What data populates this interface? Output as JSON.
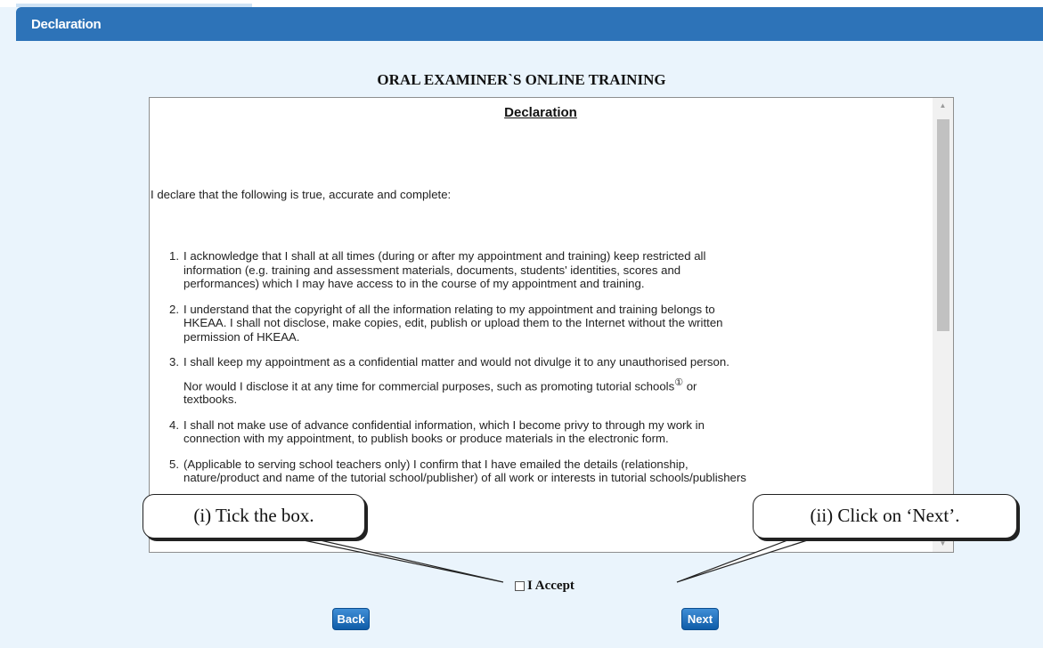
{
  "header": {
    "title": "Declaration"
  },
  "page_heading": "ORAL EXAMINER`S ONLINE TRAINING",
  "declaration": {
    "title": "Declaration",
    "intro": "I declare that the following is true, accurate and complete:",
    "items": [
      {
        "number": "1.",
        "lines": [
          "I acknowledge that I shall at all times (during or after my appointment and training) keep restricted all",
          "information (e.g. training and assessment materials, documents, students' identities, scores and",
          "performances) which I may have access to in the course of my appointment and training."
        ]
      },
      {
        "number": "2.",
        "lines": [
          "I understand that the copyright of all the information relating to my appointment and training belongs to",
          "HKEAA. I shall not disclose, make copies, edit, publish or upload them to the Internet without the written",
          "permission of HKEAA."
        ]
      },
      {
        "number": "3.",
        "first": "I shall keep my appointment as a confidential matter and would not divulge it to any unauthorised person.",
        "second_a": "Nor would I disclose it at any time for commercial purposes, such as promoting tutorial schools",
        "note_mark": "①",
        "second_b": " or",
        "third": "textbooks."
      },
      {
        "number": "4.",
        "lines": [
          "I shall not make use of advance confidential information, which I become privy to through my work in",
          "connection with my appointment, to publish books or produce materials in the electronic form."
        ]
      },
      {
        "number": "5.",
        "lines": [
          "(Applicable to serving school teachers only) I confirm that I have emailed the details (relationship,",
          "nature/product and name of the tutorial school/publisher) of all work or interests in tutorial schools/publishers"
        ]
      }
    ]
  },
  "callouts": {
    "tick": "(i) Tick the box.",
    "next": "(ii) Click on ‘Next’."
  },
  "accept_label": "I Accept",
  "buttons": {
    "back": "Back",
    "next": "Next"
  },
  "colors": {
    "header": "#2d73b8",
    "background": "#eaf4fc",
    "button": "#1a6ab8"
  }
}
